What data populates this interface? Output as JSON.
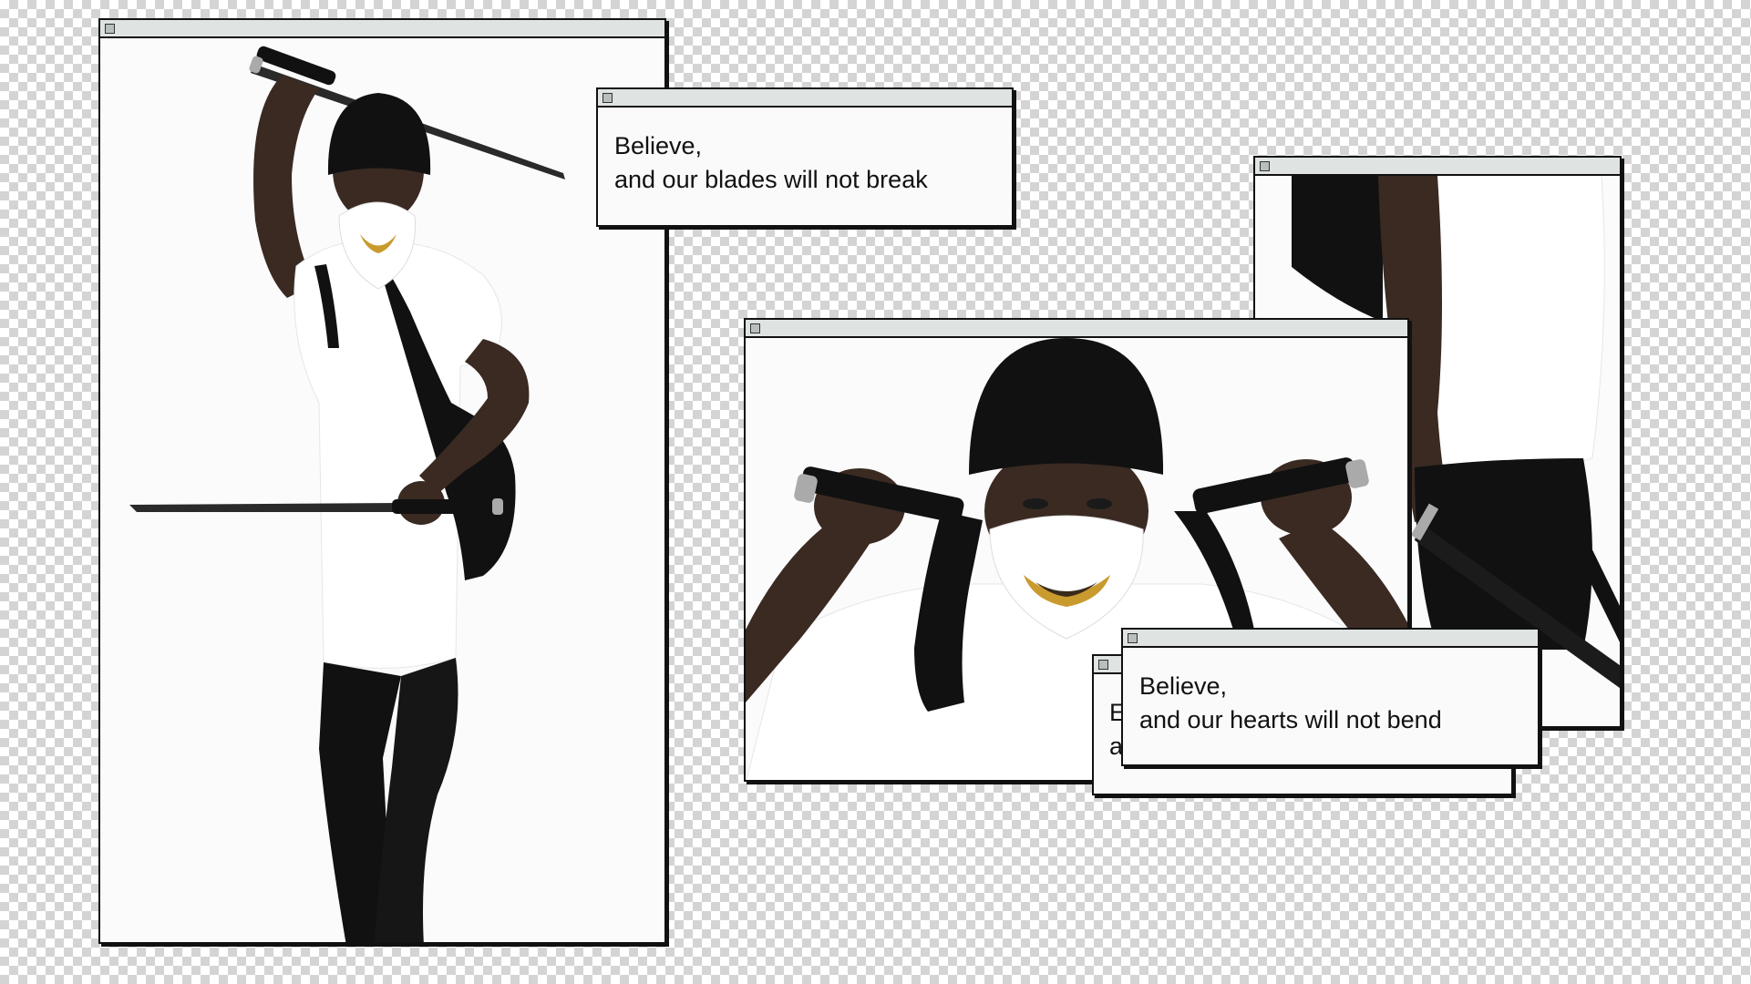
{
  "windows": {
    "photo_left": {
      "alt": "Figure holding two katanas wearing white oni mask"
    },
    "dialog_blades": {
      "line1": "Believe,",
      "line2": "and our blades will not break"
    },
    "photo_right": {
      "alt": "Torso with white t-shirt, black pants and sheathed katana"
    },
    "photo_center": {
      "alt": "Masked figure gripping two katana handles behind shoulders"
    },
    "dialog_back": {
      "line1": "E",
      "line2": "a"
    },
    "dialog_hearts": {
      "line1": "Believe,",
      "line2": "and our hearts will not bend"
    }
  },
  "colors": {
    "titlebar": "#dfe4e2",
    "border": "#111111",
    "mask_white": "#ffffff",
    "mask_gold": "#c99a2e",
    "beanie": "#111111",
    "skin": "#3a2a22"
  },
  "icons": {
    "window_close": "square-close-icon"
  }
}
